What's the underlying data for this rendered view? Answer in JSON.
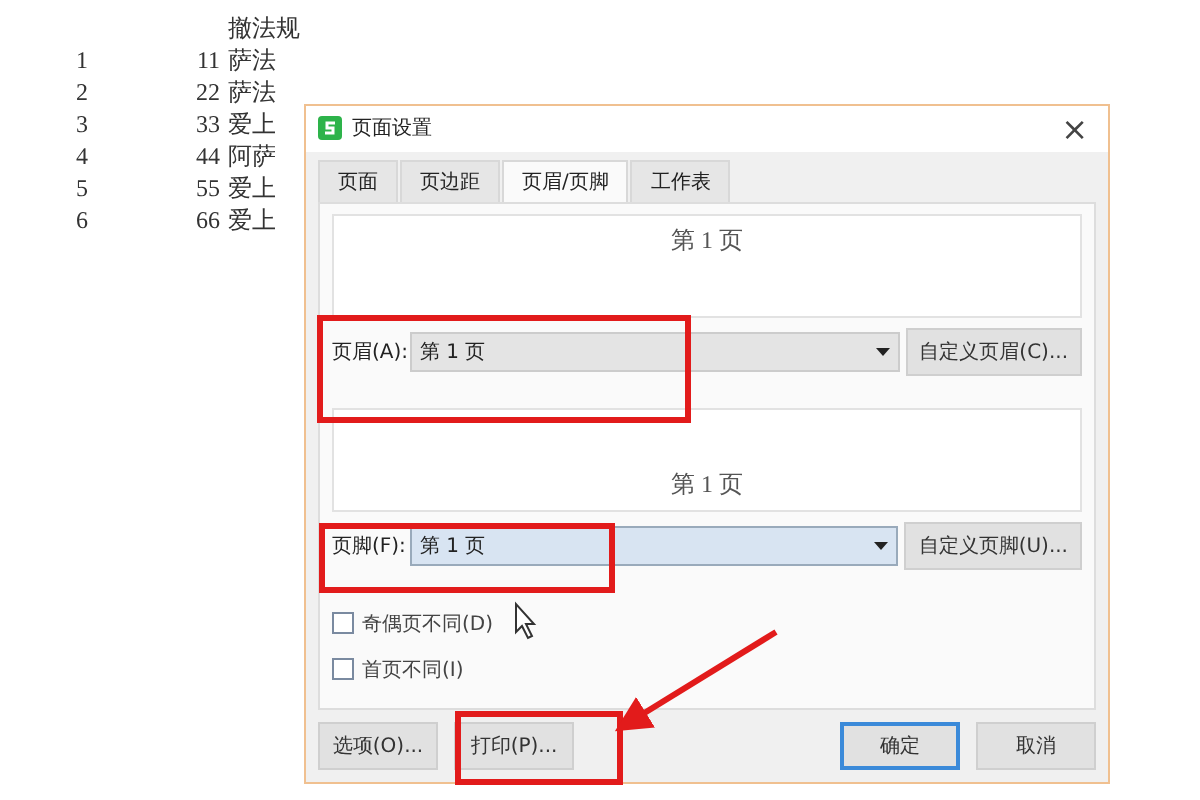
{
  "sheet": {
    "header": "撤法规",
    "rows": [
      {
        "index": "1",
        "number": "11",
        "text": "萨法"
      },
      {
        "index": "2",
        "number": "22",
        "text": "萨法"
      },
      {
        "index": "3",
        "number": "33",
        "text": "爱上"
      },
      {
        "index": "4",
        "number": "44",
        "text": " 阿萨"
      },
      {
        "index": "5",
        "number": "55",
        "text": "爱上"
      },
      {
        "index": "6",
        "number": "66",
        "text": "爱上"
      }
    ]
  },
  "dialog": {
    "title": "页面设置",
    "close": "×",
    "tabs": [
      {
        "label": "页面",
        "selected": false
      },
      {
        "label": "页边距",
        "selected": false
      },
      {
        "label": "页眉/页脚",
        "selected": true
      },
      {
        "label": "工作表",
        "selected": false
      }
    ],
    "header_preview": "第 1 页",
    "header": {
      "label": "页眉(A):",
      "value": "第 1 页",
      "focused": false,
      "button": "自定义页眉(C)..."
    },
    "footer_preview": "第 1 页",
    "footer": {
      "label": "页脚(F):",
      "value": "第 1 页",
      "focused": true,
      "button": "自定义页脚(U)..."
    },
    "checkboxes": [
      {
        "label": "奇偶页不同(D)",
        "checked": false
      },
      {
        "label": "首页不同(I)",
        "checked": false
      }
    ],
    "buttons": [
      {
        "label": "选项(O)...",
        "default": false
      },
      {
        "label": "打印(P)...",
        "default": false
      },
      {
        "label": "确定",
        "default": true
      },
      {
        "label": "取消",
        "default": false
      }
    ]
  }
}
